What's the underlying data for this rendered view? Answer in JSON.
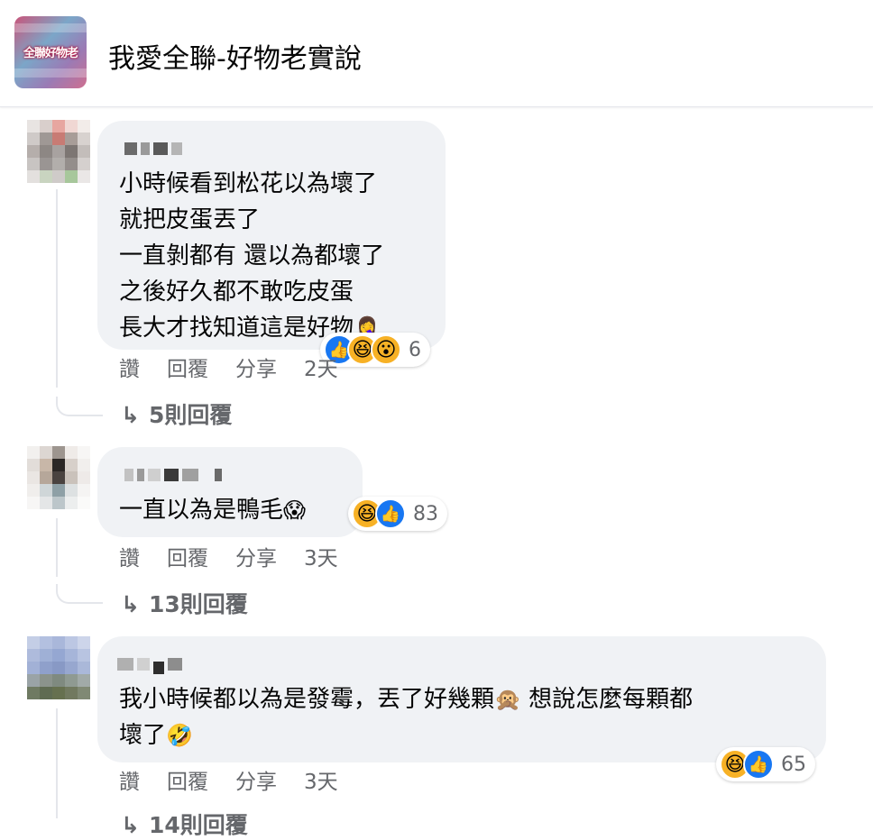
{
  "header": {
    "avatar_text": "全聯好物老",
    "title": "我愛全聯-好物老實說"
  },
  "comments": [
    {
      "text": "小時候看到松花以為壞了\n就把皮蛋丟了\n一直剝都有 還以為都壞了\n之後好久都不敢吃皮蛋\n長大才找知道這是好物",
      "text_emoji": "🤦‍♀️",
      "reactions": [
        "like-icon",
        "haha-icon",
        "wow-icon"
      ],
      "reaction_count": "6",
      "actions": [
        "讚",
        "回覆",
        "分享",
        "2天"
      ],
      "replies": "5則回覆"
    },
    {
      "text": "一直以為是鴨毛",
      "text_emoji": "😱",
      "reactions": [
        "haha-icon",
        "like-icon"
      ],
      "reaction_count": "83",
      "actions": [
        "讚",
        "回覆",
        "分享",
        "3天"
      ],
      "replies": "13則回覆"
    },
    {
      "text": "我小時候都以為是發霉，丟了好幾顆",
      "text_emoji": "🙊",
      "text_after": " 想說怎麼每顆都\n壞了",
      "text_emoji2": "🤣",
      "reactions": [
        "haha-icon",
        "like-icon"
      ],
      "reaction_count": "65",
      "actions": [
        "讚",
        "回覆",
        "分享",
        "3天"
      ],
      "replies": "14則回覆"
    }
  ],
  "colors": {
    "bubble": "#f0f2f5",
    "secondary_text": "#65676b",
    "like_blue": "#1877f2",
    "emoji_yellow": "#f7b125"
  }
}
